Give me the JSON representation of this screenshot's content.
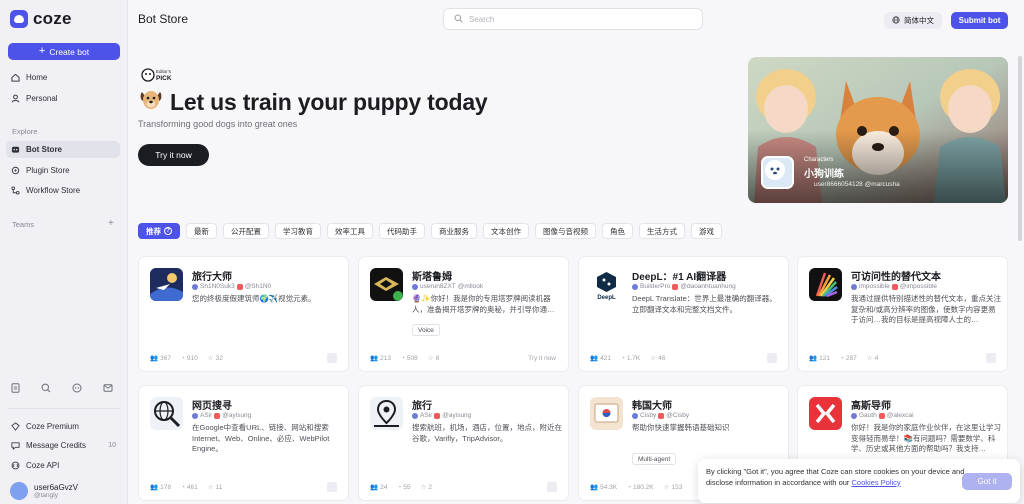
{
  "app": {
    "logo_text": "coze"
  },
  "sidebar": {
    "create_label": "Create bot",
    "items": [
      {
        "label": "Home",
        "icon": "home-icon"
      },
      {
        "label": "Personal",
        "icon": "user-icon"
      }
    ],
    "explore_label": "Explore",
    "explore_items": [
      {
        "label": "Bot Store",
        "icon": "bot-icon"
      },
      {
        "label": "Plugin Store",
        "icon": "plugin-icon"
      },
      {
        "label": "Workflow Store",
        "icon": "workflow-icon"
      }
    ],
    "teams_label": "Teams",
    "bottom_items": [
      {
        "label": "Coze Premium",
        "icon": "premium-icon"
      },
      {
        "label": "Message Credits",
        "icon": "credits-icon",
        "count": "10"
      },
      {
        "label": "Coze API",
        "icon": "api-icon"
      }
    ],
    "user": {
      "name": "user6aGvzV",
      "handle": "@tangly"
    }
  },
  "header": {
    "title": "Bot Store",
    "search_placeholder": "Search",
    "language": "简体中文",
    "submit_label": "Submit bot"
  },
  "hero": {
    "badge_top": "Editor's",
    "badge_bottom": "PICK",
    "title": "Let us train your puppy today",
    "subtitle": "Transforming good dogs into great ones",
    "cta": "Try it now",
    "featured": {
      "category": "Characters",
      "name": "小狗训练",
      "author": "user866605412​8 @marcusha"
    }
  },
  "tabs": [
    "推荐",
    "最新",
    "公开配置",
    "学习教育",
    "效率工具",
    "代码助手",
    "商业服务",
    "文本创作",
    "图像与音视频",
    "角色",
    "生活方式",
    "游戏"
  ],
  "cards": [
    {
      "title": "旅行大师",
      "author": "Sh1N0Suk3",
      "handle": "@Sh1N0",
      "desc": "您的终极度假建筑师🌍✈️视觉元素。",
      "tag": "",
      "stats": [
        "367",
        "910",
        "32"
      ],
      "try": ""
    },
    {
      "title": "斯塔鲁姆",
      "author": "userun8ZXT",
      "handle": "@mllook",
      "desc": "🔮✨你好！我是你的专用塔罗牌阅读机器人，准备揭开塔罗牌的奥秘，并引导你通…",
      "tag": "Voice",
      "stats": [
        "213",
        "508",
        "8"
      ],
      "try": "Try it now"
    },
    {
      "title": "DeepL：#1 AI翻译器",
      "author": "BuilderPro",
      "handle": "@daoanhtuanhung",
      "desc": "DeepL Translate：世界上最准确的翻译器。立即翻译文本和完整文档文件。",
      "tag": "",
      "stats": [
        "421",
        "1.7K",
        "46"
      ],
      "try": ""
    },
    {
      "title": "可访问性的替代文本",
      "author": "impossible",
      "handle": "@impossible",
      "desc": "我通过提供特别描述性的替代文本，重点关注复杂和/或高分辨率的图像，使数字内容更易于访问…我的目标是提高视障人士的…",
      "tag": "",
      "stats": [
        "121",
        "287",
        "4"
      ],
      "try": ""
    },
    {
      "title": "网页搜寻",
      "author": "ASir",
      "handle": "@ayisung",
      "desc": "在Google中查看URL、链接、网站和搜索Internet、Web、Online、必应、WebPilot Engine。",
      "tag": "",
      "stats": [
        "178",
        "461",
        "11"
      ],
      "try": ""
    },
    {
      "title": "旅行",
      "author": "ASir",
      "handle": "@ayisung",
      "desc": "搜索航班，机场，酒店，位置，地点，附近在谷歌，Varifly，TripAdvisor。",
      "tag": "",
      "stats": [
        "24",
        "55",
        "2"
      ],
      "try": ""
    },
    {
      "title": "韩国大师",
      "author": "Cisby",
      "handle": "@Cisby",
      "desc": "帮助你快速掌握韩语基础知识",
      "tag": "Multi-agent",
      "stats": [
        "54.3K",
        "180.2K",
        "153"
      ],
      "try": ""
    },
    {
      "title": "高斯导师",
      "author": "Gauth",
      "handle": "@alexcai",
      "desc": "你好！我是你的家庭作业伙伴，在这里让学习变得轻而易举！📚有问题吗？需要数学、科学、历史或其他方面的帮助吗？我支持…",
      "tag": "",
      "stats": [
        "",
        "",
        ""
      ],
      "try": ""
    }
  ],
  "cookie": {
    "text": "By clicking \"Got it\", you agree that Coze can store cookies on your device and disclose information in accordance with our",
    "link": "Cookies Policy",
    "button": "Got it"
  },
  "colors": {
    "brand": "#4d53e8",
    "dark": "#1c1d23"
  }
}
